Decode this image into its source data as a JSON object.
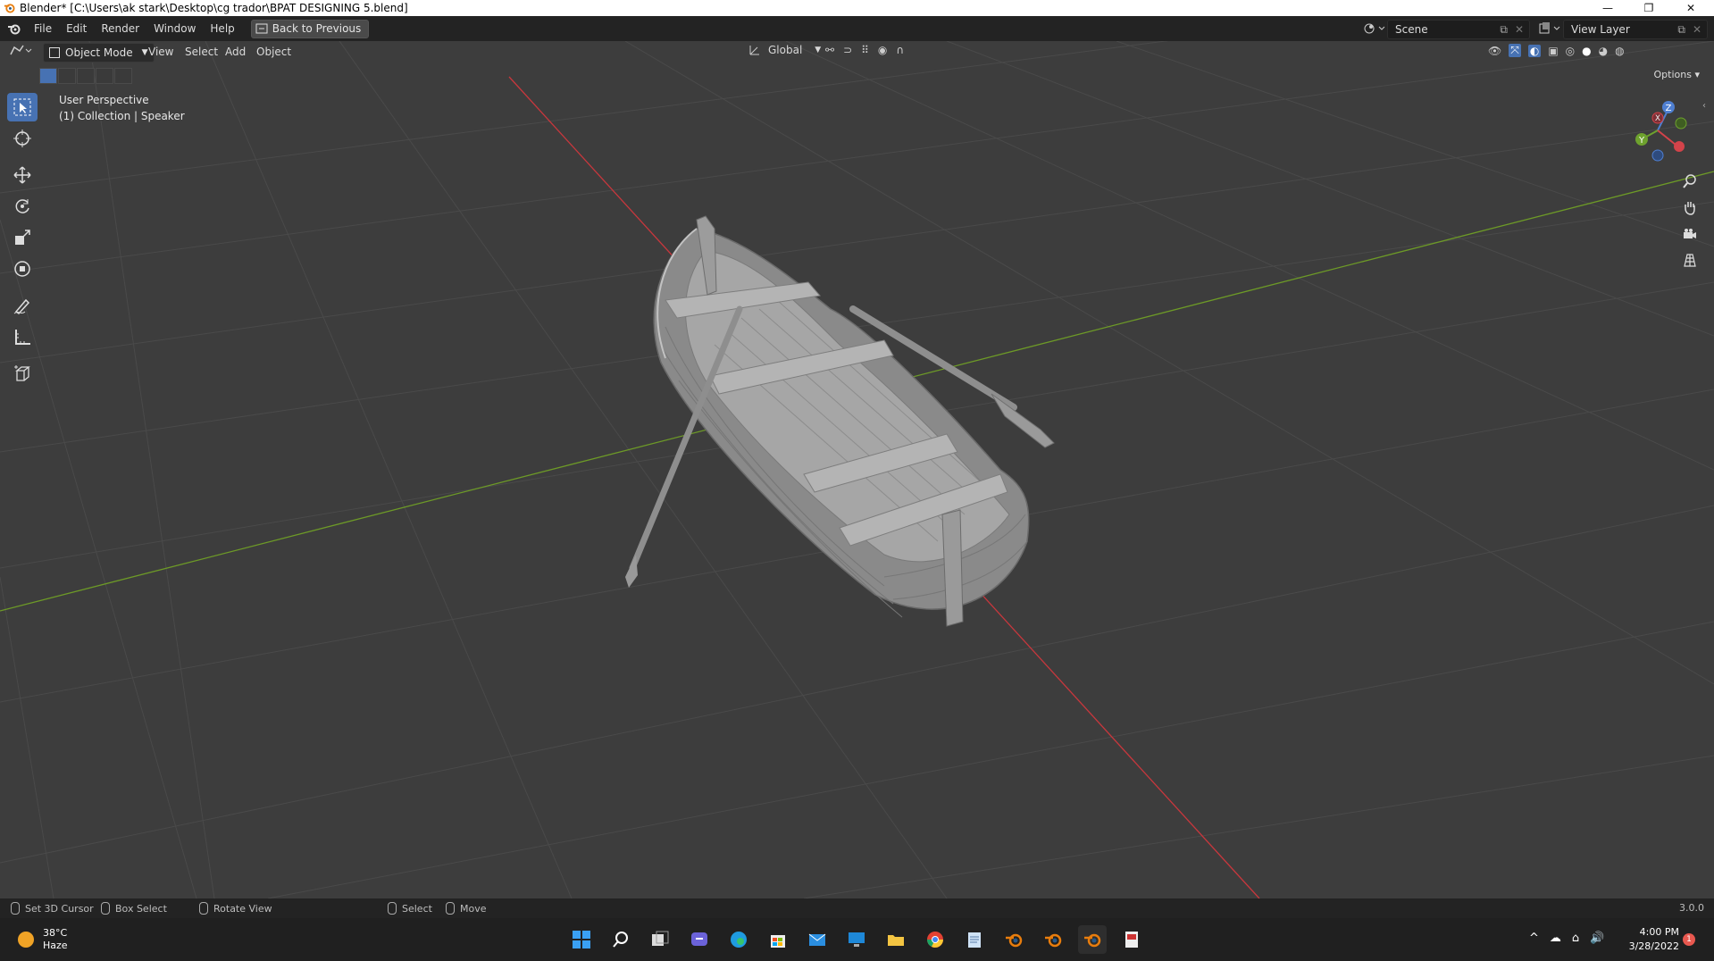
{
  "window": {
    "title": "Blender* [C:\\Users\\ak stark\\Desktop\\cg trador\\BPAT DESIGNING 5.blend]",
    "minimize": "—",
    "restore": "❐",
    "close": "✕"
  },
  "topbar": {
    "menus": [
      "File",
      "Edit",
      "Render",
      "Window",
      "Help"
    ],
    "back_button": "Back to Previous",
    "scene_label": "Scene",
    "view_layer_label": "View Layer"
  },
  "viewport_header": {
    "mode": "Object Mode",
    "menus": [
      "View",
      "Select",
      "Add",
      "Object"
    ],
    "orientation": "Global",
    "options": "Options"
  },
  "viewport": {
    "perspective": "User Perspective",
    "collection": "(1) Collection | Speaker",
    "version": "3.0.0",
    "gizmo": {
      "x": "X",
      "y": "Y",
      "z": "Z"
    }
  },
  "statusbar": {
    "set_cursor": "Set 3D Cursor",
    "box_select": "Box Select",
    "rotate_view": "Rotate View",
    "select": "Select",
    "move": "Move"
  },
  "taskbar": {
    "weather_temp": "38°C",
    "weather_desc": "Haze",
    "time": "4:00 PM",
    "date": "3/28/2022",
    "notification_count": "1"
  },
  "colors": {
    "x_axis": "#c8373d",
    "y_axis": "#6d9a27",
    "accent": "#4772b3"
  }
}
